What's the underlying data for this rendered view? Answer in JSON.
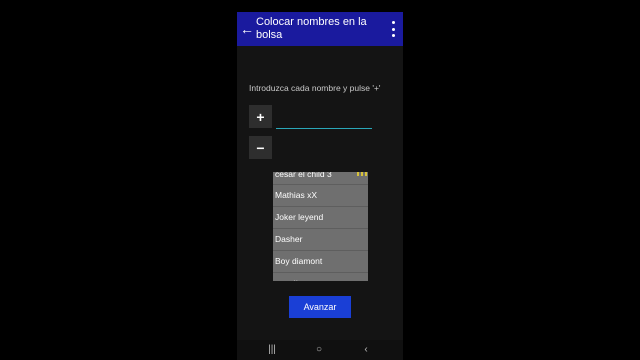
{
  "appbar": {
    "title": "Colocar nombres en la bolsa",
    "back_icon": "←",
    "more_icon": "more-vert"
  },
  "instructions": "Introduzca cada nombre y pulse '+'",
  "buttons": {
    "add_label": "+",
    "remove_label": "−",
    "advance_label": "Avanzar"
  },
  "name_input": {
    "value": "",
    "placeholder": ""
  },
  "names_list": {
    "items": [
      "cesar el child 3",
      "Mathias xX",
      "Joker leyend",
      "Dasher",
      "Boy diamont",
      "vegetto pro"
    ]
  },
  "navbar": {
    "recents": "|||",
    "home": "○",
    "back": "‹"
  },
  "colors": {
    "appbar": "#1a1a9e",
    "background": "#141414",
    "list_background": "#6f6f6f",
    "advance_button": "#1a3fd6",
    "input_underline": "#2aa7b8"
  }
}
